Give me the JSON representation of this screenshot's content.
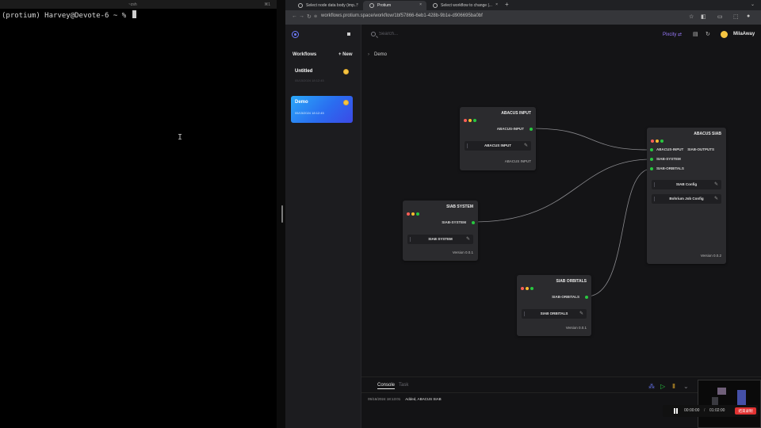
{
  "terminal": {
    "window_title": "~zsh",
    "shortcut": "⌘1",
    "prompt": "(protium) Harvey@Devote-6 ~ % "
  },
  "browser": {
    "tabs": [
      {
        "label": "Select node data body (imp...",
        "active": false
      },
      {
        "label": "Protium",
        "active": true
      },
      {
        "label": "Select workflow to change |...",
        "active": false
      }
    ],
    "new_tab": "+",
    "url": "workflows.protium.space/workflow/1bf57866-6eb1-428b-9b1e-d906695ba0bf"
  },
  "app": {
    "search_placeholder": "Search...",
    "pixcity_label": "Pixcity",
    "user_name": "MilaAway",
    "sidebar": {
      "heading": "Workflows",
      "new_label": "+ New",
      "workflows": [
        {
          "title": "Untitled",
          "date": "05/15/2024 18:12:45"
        },
        {
          "title": "Demo",
          "date": "05/15/2024 18:12:45"
        }
      ]
    },
    "breadcrumb": "Demo",
    "nodes": {
      "abacus_input": {
        "title": "ABACUS INPUT",
        "output": "ABACUS-INPUT",
        "field": "ABACUS INPUT",
        "footer": "ABACUS INPUT"
      },
      "siab_system": {
        "title": "SIAB SYSTEM",
        "output": "SIAB-SYSTEM",
        "field": "SIAB SYSTEM",
        "version": "Version 0.0.1"
      },
      "siab_orbitals": {
        "title": "SIAB ORBITALS",
        "output": "SIAB-ORBITALS",
        "field": "SIAB ORBITALS",
        "version": "Version 0.0.1"
      },
      "abacus_siab": {
        "title": "ABACUS SIAB",
        "inputs": [
          "ABACUS-INPUT",
          "SIAB-SYSTEM",
          "SIAB-ORBITALS"
        ],
        "output": "SIAB-OUTPUTS",
        "fields": [
          "SIAB Config",
          "Bohrium Job Config"
        ],
        "version": "Version 0.0.2"
      }
    },
    "console": {
      "tabs": [
        "Console",
        "Task"
      ],
      "log_time": "05/16/2024 18:13:01",
      "log_message": "Added, ABACUS SIAB"
    }
  },
  "recording": {
    "elapsed": "00:00:00",
    "total": "01:02:00",
    "end_label": "结束录制"
  },
  "colors": {
    "accent_gradient_start": "#2aa8f8",
    "accent_gradient_end": "#3c49e6",
    "port_green": "#28c840",
    "pixcity_purple": "#9b7bff"
  }
}
